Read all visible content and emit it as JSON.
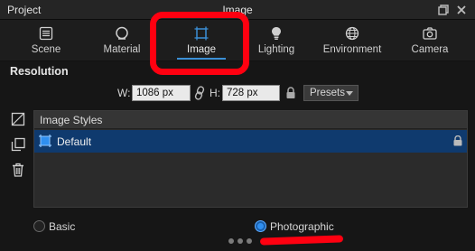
{
  "window": {
    "title_left": "Project",
    "title_center": "Image"
  },
  "tabs": [
    {
      "label": "Scene",
      "icon": "scene-icon"
    },
    {
      "label": "Material",
      "icon": "material-icon"
    },
    {
      "label": "Image",
      "icon": "image-frame-icon",
      "active": true
    },
    {
      "label": "Lighting",
      "icon": "bulb-icon"
    },
    {
      "label": "Environment",
      "icon": "globe-icon"
    },
    {
      "label": "Camera",
      "icon": "camera-icon"
    }
  ],
  "resolution": {
    "title": "Resolution",
    "width_label": "W:",
    "width_value": "1086 px",
    "height_label": "H:",
    "height_value": "728 px",
    "presets_label": "Presets"
  },
  "image_styles": {
    "header": "Image Styles",
    "items": [
      {
        "name": "Default",
        "locked": true,
        "selected": true
      }
    ]
  },
  "render_mode": {
    "options": [
      {
        "label": "Basic",
        "selected": false
      },
      {
        "label": "Photographic",
        "selected": true
      }
    ]
  },
  "colors": {
    "accent": "#2f8ff0",
    "selection": "#0f3a6e",
    "annotation": "#ff0010"
  }
}
